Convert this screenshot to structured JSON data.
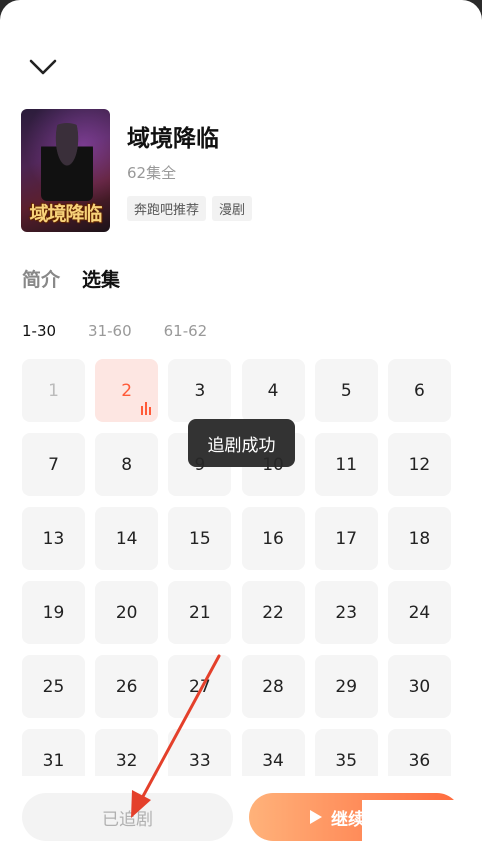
{
  "show": {
    "title": "域境降临",
    "cover_text": "域境降临",
    "episode_count": "62集全",
    "tags": [
      "奔跑吧推荐",
      "漫剧"
    ]
  },
  "tabs": [
    {
      "label": "简介",
      "active": false
    },
    {
      "label": "选集",
      "active": true
    }
  ],
  "ranges": [
    {
      "label": "1-30",
      "active": true
    },
    {
      "label": "31-60",
      "active": false
    },
    {
      "label": "61-62",
      "active": false
    }
  ],
  "episodes": {
    "labels": [
      "1",
      "2",
      "3",
      "4",
      "5",
      "6",
      "7",
      "8",
      "9",
      "10",
      "11",
      "12",
      "13",
      "14",
      "15",
      "16",
      "17",
      "18",
      "19",
      "20",
      "21",
      "22",
      "23",
      "24",
      "25",
      "26",
      "27",
      "28",
      "29",
      "30",
      "31",
      "32",
      "33",
      "34",
      "35",
      "36"
    ],
    "watched": "1",
    "current": "2"
  },
  "toast": {
    "text": "追剧成功"
  },
  "actions": {
    "following_label": "已追剧",
    "continue_label": "继续"
  },
  "colors": {
    "accent": "#ff5a38",
    "arrow": "#e4402b"
  },
  "icons": {
    "collapse": "chevron-down-icon",
    "playing": "playing-bars-icon",
    "play": "play-icon"
  }
}
